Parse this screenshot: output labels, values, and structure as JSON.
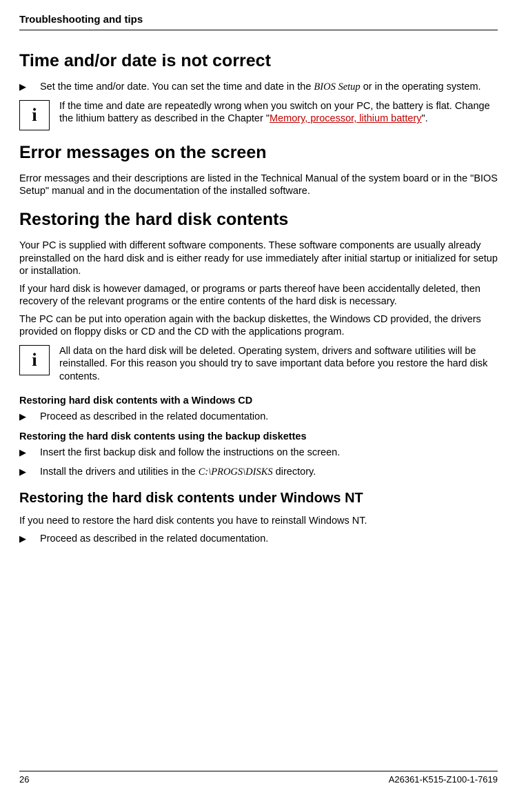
{
  "header": {
    "title": "Troubleshooting and tips"
  },
  "section1": {
    "heading": "Time and/or date is not correct",
    "bullet1_pre": "Set the time and/or date. You can set the time and date in the ",
    "bullet1_em": "BIOS Setup",
    "bullet1_post": " or in the operating system.",
    "info_pre": "If the time and date are repeatedly wrong when you switch on your PC, the battery is flat. Change the lithium battery as described in the Chapter  \"",
    "info_link": "Memory, processor, lithium battery",
    "info_post": "\"."
  },
  "section2": {
    "heading": "Error messages on the screen",
    "para": "Error messages and their descriptions are listed in the Technical Manual of the system board or in the \"BIOS Setup\" manual and in the documentation of the installed software."
  },
  "section3": {
    "heading": "Restoring the hard disk contents",
    "para1": "Your PC is supplied with different software components. These software components are usually already preinstalled on the hard disk and is either ready for use immediately after initial startup or initialized for setup or installation.",
    "para2": "If your hard disk is however damaged, or programs or parts thereof have been accidentally deleted, then recovery of the relevant programs or the entire contents of the hard disk is necessary.",
    "para3": "The PC can be put into operation again with the backup diskettes, the Windows CD provided, the drivers provided on floppy disks or CD and the CD with the applications program.",
    "info": "All data on the hard disk will be deleted. Operating system, drivers and software utilities will be reinstalled. For this reason you should try to save important data before you restore the hard disk contents.",
    "sub_a_title": "Restoring hard disk contents with a Windows CD",
    "sub_a_bullet": "Proceed as described in the related documentation.",
    "sub_b_title": "Restoring the hard disk contents using the backup diskettes",
    "sub_b_bullet1": "Insert the first backup disk and follow the instructions on the screen.",
    "sub_b_bullet2_pre": "Install the drivers and utilities in the ",
    "sub_b_bullet2_em": "C:\\PROGS\\DISKS",
    "sub_b_bullet2_post": " directory."
  },
  "section4": {
    "heading": "Restoring the hard disk contents under Windows NT",
    "para": "If you need to restore the hard disk contents you have to reinstall Windows NT.",
    "bullet": "Proceed as described in the related documentation."
  },
  "footer": {
    "page": "26",
    "doc": "A26361-K515-Z100-1-7619"
  },
  "glyphs": {
    "bullet": "▶",
    "info": "i"
  }
}
